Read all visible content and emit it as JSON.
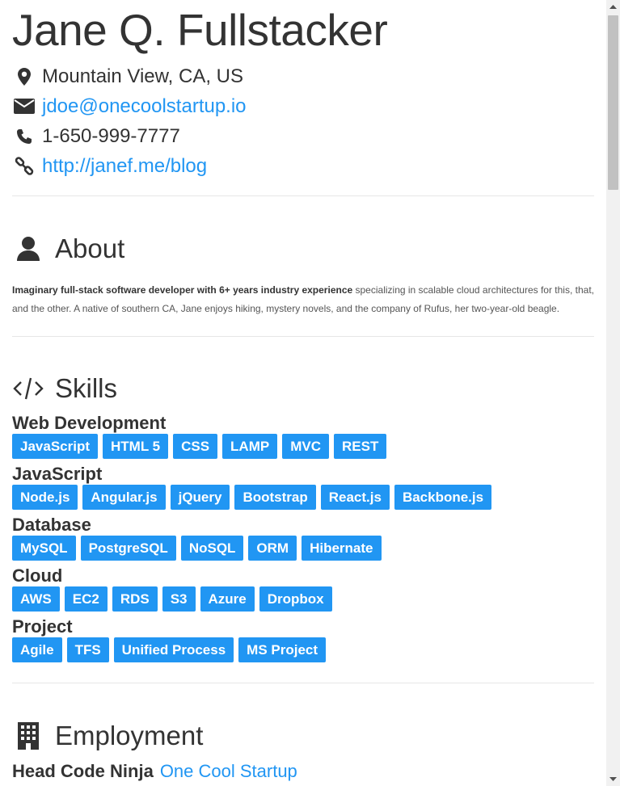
{
  "header": {
    "name": "Jane Q. Fullstacker",
    "location": "Mountain View, CA, US",
    "email": "jdoe@onecoolstartup.io",
    "phone": "1-650-999-7777",
    "website": "http://janef.me/blog"
  },
  "about": {
    "title": "About",
    "bold_text": "Imaginary full-stack software developer with 6+ years industry experience",
    "text": " specializing in scalable cloud architectures for this, that, and the other. A native of southern CA, Jane enjoys hiking, mystery novels, and the company of Rufus, her two-year-old beagle."
  },
  "skills": {
    "title": "Skills",
    "groups": [
      {
        "name": "Web Development",
        "items": [
          "JavaScript",
          "HTML 5",
          "CSS",
          "LAMP",
          "MVC",
          "REST"
        ]
      },
      {
        "name": "JavaScript",
        "items": [
          "Node.js",
          "Angular.js",
          "jQuery",
          "Bootstrap",
          "React.js",
          "Backbone.js"
        ]
      },
      {
        "name": "Database",
        "items": [
          "MySQL",
          "PostgreSQL",
          "NoSQL",
          "ORM",
          "Hibernate"
        ]
      },
      {
        "name": "Cloud",
        "items": [
          "AWS",
          "EC2",
          "RDS",
          "S3",
          "Azure",
          "Dropbox"
        ]
      },
      {
        "name": "Project",
        "items": [
          "Agile",
          "TFS",
          "Unified Process",
          "MS Project"
        ]
      }
    ]
  },
  "employment": {
    "title": "Employment",
    "first_job": {
      "position": "Head Code Ninja",
      "company": "One Cool Startup"
    }
  },
  "colors": {
    "accent": "#2196F3",
    "text": "#333333",
    "divider": "#e6e6e6"
  }
}
